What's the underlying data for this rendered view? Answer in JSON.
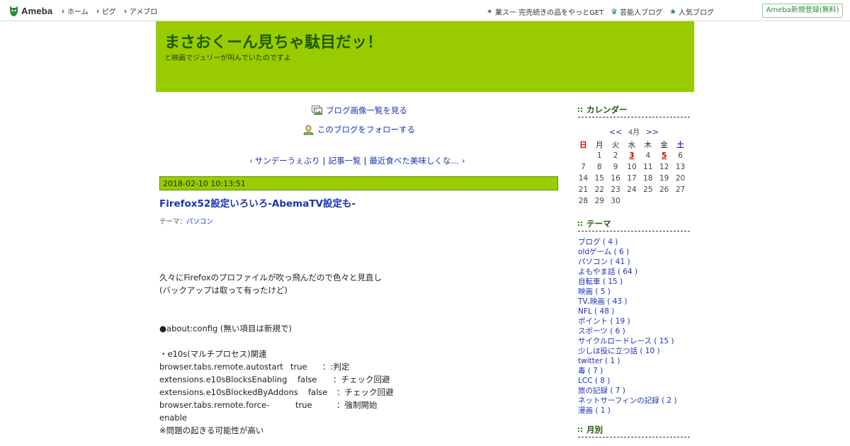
{
  "topbar": {
    "logo": "Ameba",
    "nav": [
      "ホーム",
      "ピグ",
      "アメブロ"
    ],
    "right": [
      {
        "icon": "sparkle-icon",
        "label": "業スー 完売続きの品をやっとGET"
      },
      {
        "icon": "crown-icon",
        "label": "芸能人ブログ"
      },
      {
        "icon": "star-icon",
        "label": "人気ブログ"
      }
    ],
    "register": "Ameba新規登録(無料)"
  },
  "header": {
    "title": "まさおくーん見ちゃ駄目だッ！",
    "subtitle": "と映画でジュリーが叫んでいたのですよ"
  },
  "links": {
    "images": "ブログ画像一覧を見る",
    "follow": "このブログをフォローする"
  },
  "pager": {
    "prev": "サンデーうぇぶり",
    "list": "記事一覧",
    "next": "最近食べた美味しくな…"
  },
  "entry": {
    "date": "2018-02-10 10:13:51",
    "title": "Firefox52設定いろいろ-AbemaTV設定も-",
    "theme_label": "テーマ：",
    "theme": "パソコン",
    "lines": [
      "久々にFirefoxのプロファイルが吹っ飛んだので色々と見直し",
      "(バックアップは取って有ったけど)",
      "",
      "",
      "●about:config (無い項目は新規で)",
      "",
      "・e10s(マルチプロセス)関連"
    ],
    "settings": [
      {
        "key": "browser.tabs.remote.autostart",
        "val": "true",
        "note": "：:判定"
      },
      {
        "key": "extensions.e10sBlocksEnabling",
        "val": "false",
        "note": "：チェック回避"
      },
      {
        "key": "extensions.e10sBlockedByAddons",
        "val": "false",
        "note": "：チェック回避"
      },
      {
        "key": "browser.tabs.remote.force-enable",
        "val": "true",
        "note": "：強制開始"
      }
    ],
    "note": "※問題の起きる可能性が高い"
  },
  "sidebar": {
    "calendar": {
      "heading": "カレンダー",
      "prev": "<<",
      "month": "4月",
      "next": ">>",
      "weekdays": [
        "日",
        "月",
        "火",
        "水",
        "木",
        "金",
        "土"
      ],
      "weeks": [
        [
          "",
          "1",
          "2",
          "3",
          "4",
          "5",
          "6"
        ],
        [
          "7",
          "8",
          "9",
          "10",
          "11",
          "12",
          "13"
        ],
        [
          "14",
          "15",
          "16",
          "17",
          "18",
          "19",
          "20"
        ],
        [
          "21",
          "22",
          "23",
          "24",
          "25",
          "26",
          "27"
        ],
        [
          "28",
          "29",
          "30",
          "",
          "",
          "",
          ""
        ]
      ],
      "linked_days": [
        "3",
        "5"
      ]
    },
    "themes": {
      "heading": "テーマ",
      "items": [
        "ブログ ( 4 )",
        "oldゲーム ( 6 )",
        "パソコン ( 41 )",
        "よもやま話 ( 64 )",
        "自転車 ( 15 )",
        "映画 ( 5 )",
        "TV,映画 ( 43 )",
        "NFL ( 48 )",
        "ポイント ( 19 )",
        "スポーツ ( 6 )",
        "サイクルロードレース ( 15 )",
        "少しは役に立つ話 ( 10 )",
        "twitter ( 1 )",
        "毒 ( 7 )",
        "LCC ( 8 )",
        "旅の記録 ( 7 )",
        "ネットサーフィンの記録 ( 2 )",
        "漫画 ( 1 )"
      ]
    },
    "monthly": {
      "heading": "月別"
    }
  }
}
